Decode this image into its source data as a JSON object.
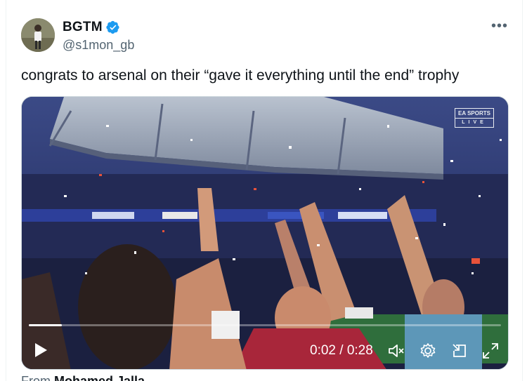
{
  "tweet": {
    "display_name": "BGTM",
    "handle": "@s1mon_gb",
    "text": "congrats to arsenal on their “gave it everything until the end” trophy",
    "more_label": "•••"
  },
  "video": {
    "badge_brand": "EA SPORTS",
    "badge_live": "LIVE",
    "time_current": "0:02",
    "time_total": "0:28",
    "time_display": "0:02 / 0:28",
    "progress_fraction": 0.07
  },
  "from": {
    "prefix": "From",
    "source": "Mohamed Jalla"
  },
  "colors": {
    "verified": "#1d9bf0",
    "text_secondary": "#536471",
    "text_primary": "#0f1419"
  }
}
